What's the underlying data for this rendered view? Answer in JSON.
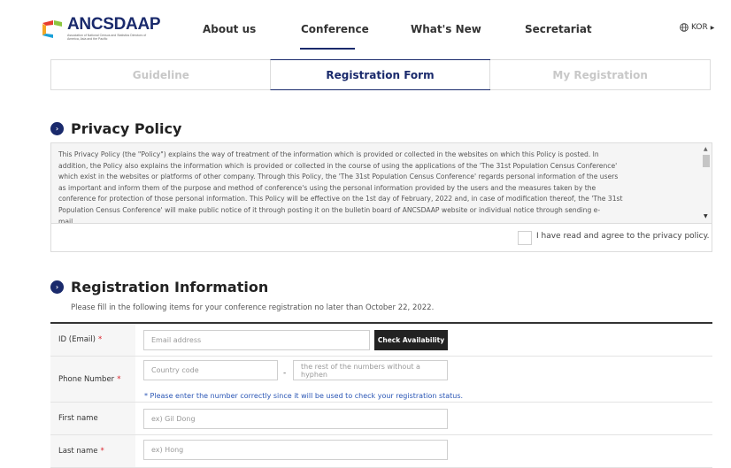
{
  "nav": {
    "logo_text": "ANCSDAAP",
    "logo_sub": "Association of National Census and Statistics Directors of America, Asia and the Pacific",
    "items": [
      "About us",
      "Conference",
      "What's New",
      "Secretariat"
    ],
    "lang": "KOR"
  },
  "tabs": [
    "Guideline",
    "Registration Form",
    "My Registration"
  ],
  "privacy": {
    "title": "Privacy Policy",
    "lines": [
      "This Privacy Policy (the \"Policy\") explains the way of treatment of the information which is provided or collected in the websites on which this Policy is posted. In",
      "addition, the Policy also explains the information which is provided or collected in the course of using the applications of the 'The 31st Population Census Conference'",
      "which exist in the websites or platforms of other company. Through this Policy, the 'The 31st Population Census Conference' regards personal information of the users",
      "as important and inform them of the purpose and method of conference's using the personal information provided by the users and the measures taken by the",
      "conference for protection of those personal information. This Policy will be effective on the 1st day of February, 2022 and, in case of modification thereof, the 'The 31st",
      "Population Census Conference' will make public notice of it through posting it on the bulletin board of ANCSDAAP website or individual notice through sending e-",
      "mail."
    ],
    "agree_label": "I have read and agree to the privacy policy."
  },
  "registration": {
    "title": "Registration Information",
    "note": "Please fill in the following items for your conference registration no later than October 22, 2022.",
    "id_label": "ID (Email)",
    "id_placeholder": "Email address",
    "check_btn": "Check Availability",
    "phone_label": "Phone Number",
    "country_placeholder": "Country code",
    "dash": "-",
    "rest_placeholder": "the rest of the numbers without a hyphen",
    "phone_hint": "* Please enter the number correctly since it will be used to check your registration status.",
    "first_label": "First name",
    "first_placeholder": "ex) Gil Dong",
    "last_label": "Last name",
    "last_placeholder": "ex) Hong",
    "required_mark": "*"
  },
  "colors": {
    "brand": "#1a2a6c",
    "required": "#d9242d",
    "hint": "#2a56b5"
  }
}
